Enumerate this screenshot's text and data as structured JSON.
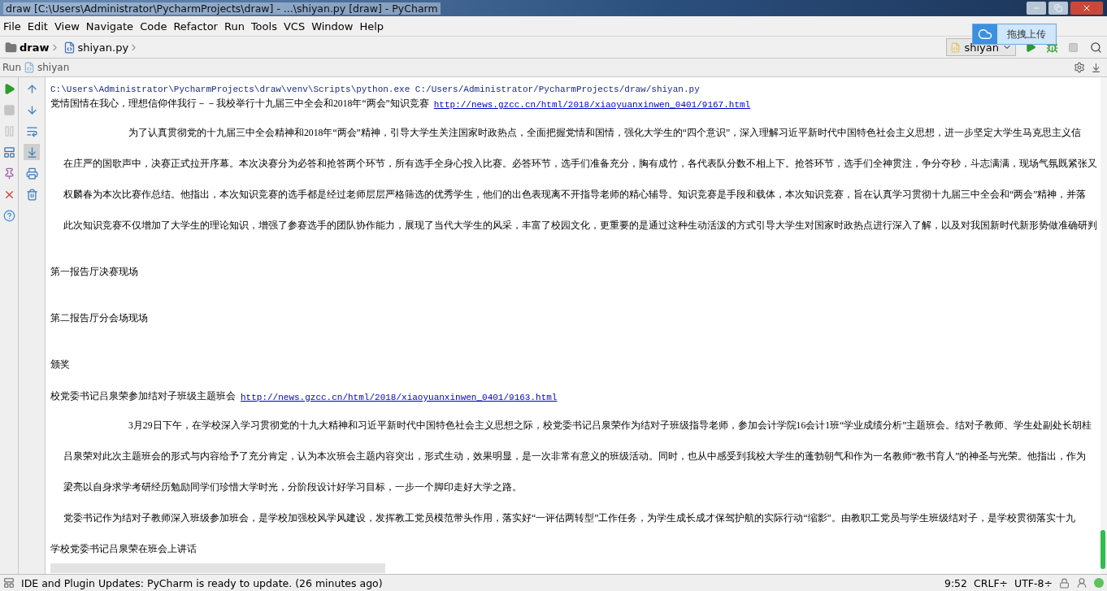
{
  "window": {
    "title": "draw [C:\\Users\\Administrator\\PycharmProjects\\draw] - ...\\shiyan.py [draw] - PyCharm"
  },
  "menu": [
    "File",
    "Edit",
    "View",
    "Navigate",
    "Code",
    "Refactor",
    "Run",
    "Tools",
    "VCS",
    "Window",
    "Help"
  ],
  "breadcrumbs": [
    {
      "label": "draw",
      "kind": "folder"
    },
    {
      "label": "shiyan.py",
      "kind": "file"
    }
  ],
  "upload_tip": {
    "label": "拖拽上传"
  },
  "run_config": {
    "label": "shiyan"
  },
  "run_panel": {
    "label": "Run",
    "config": "shiyan"
  },
  "left_tools": [
    {
      "kind": "run",
      "disabled": false
    },
    {
      "kind": "stop",
      "disabled": true
    },
    {
      "kind": "pause",
      "disabled": true
    },
    {
      "kind": "layout",
      "disabled": false
    },
    {
      "kind": "pin",
      "disabled": false
    },
    {
      "kind": "close",
      "disabled": false
    },
    {
      "kind": "help",
      "disabled": false
    }
  ],
  "console_tools": [
    {
      "kind": "up",
      "selected": false
    },
    {
      "kind": "down",
      "selected": false
    },
    {
      "kind": "wrap",
      "selected": false
    },
    {
      "kind": "scroll-end",
      "selected": true
    },
    {
      "kind": "print",
      "selected": false
    },
    {
      "kind": "trash",
      "selected": false
    }
  ],
  "output": [
    {
      "kind": "command",
      "text": "C:\\Users\\Administrator\\PycharmProjects\\draw\\venv\\Scripts\\python.exe C:/Users/Administrator/PycharmProjects/draw/shiyan.py"
    },
    {
      "kind": "link",
      "text": "党情国情在我心，理想信仰伴我行－－我校举行十九届三中全会和2018年“两会”知识竞赛",
      "url": "http://news.gzcc.cn/html/2018/xiaoyuanxinwen_0401/9167.html"
    },
    {
      "kind": "lead",
      "text": "为了认真贯彻党的十九届三中全会精神和2018年“两会”精神，引导大学生关注国家时政热点，全面把握党情和国情，强化大学生的“四个意识”，深入理解习近平新时代中国特色社会主义思想，进一步坚定大学生马克思主义信"
    },
    {
      "kind": "para",
      "text": "在庄严的国歌声中，决赛正式拉开序幕。本次决赛分为必答和抢答两个环节，所有选手全身心投入比赛。必答环节，选手们准备充分，胸有成竹，各代表队分数不相上下。抢答环节，选手们全神贯注，争分夺秒，斗志满满，现场气氛既紧张又"
    },
    {
      "kind": "para",
      "text": "权麟春为本次比赛作总结。他指出，本次知识竞赛的选手都是经过老师层层严格筛选的优秀学生，他们的出色表现离不开指导老师的精心辅导。知识竞赛是手段和载体，本次知识竞赛，旨在认真学习贯彻十九届三中全会和“两会”精神，并落"
    },
    {
      "kind": "para",
      "text": "此次知识竞赛不仅增加了大学生的理论知识，增强了参赛选手的团队协作能力，展现了当代大学生的风采，丰富了校园文化，更重要的是通过这种生动活泼的方式引导大学生对国家时政热点进行深入了解，以及对我国新时代新形势做准确研判"
    },
    {
      "kind": "section",
      "text": "第一报告厅决赛现场"
    },
    {
      "kind": "section",
      "text": "第二报告厅分会场现场"
    },
    {
      "kind": "section",
      "text": "颁奖"
    },
    {
      "kind": "link",
      "text": "校党委书记吕泉荣参加结对子班级主题班会",
      "url": "http://news.gzcc.cn/html/2018/xiaoyuanxinwen_0401/9163.html"
    },
    {
      "kind": "lead",
      "text": "3月29日下午，在学校深入学习贯彻党的十九大精神和习近平新时代中国特色社会主义思想之际，校党委书记吕泉荣作为结对子班级指导老师，参加会计学院16会计1班“学业成绩分析”主题班会。结对子教师、学生处副处长胡桂"
    },
    {
      "kind": "para",
      "text": "吕泉荣对此次主题班会的形式与内容给予了充分肯定，认为本次班会主题内容突出，形式生动，效果明显，是一次非常有意义的班级活动。同时，也从中感受到我校大学生的蓬勃朝气和作为一名教师“教书育人”的神圣与光荣。他指出，作为"
    },
    {
      "kind": "para",
      "text": "梁亮以自身求学考研经历勉励同学们珍惜大学时光，分阶段设计好学习目标，一步一个脚印走好大学之路。"
    },
    {
      "kind": "para",
      "text": "党委书记作为结对子教师深入班级参加班会，是学校加强校风学风建设，发挥教工党员模范带头作用，落实好“一评估两转型”工作任务，为学生成长成才保驾护航的实际行动“缩影”。由教职工党员与学生班级结对子，是学校贯彻落实十九"
    },
    {
      "kind": "caption",
      "text": "学校党委书记吕泉荣在班会上讲话"
    },
    {
      "kind": "image"
    }
  ],
  "status_bar": {
    "message": "IDE and Plugin Updates: PyCharm is ready to update. (26 minutes ago)",
    "position": "9:52",
    "line_separator": "CRLF÷",
    "encoding": "UTF-8÷"
  }
}
